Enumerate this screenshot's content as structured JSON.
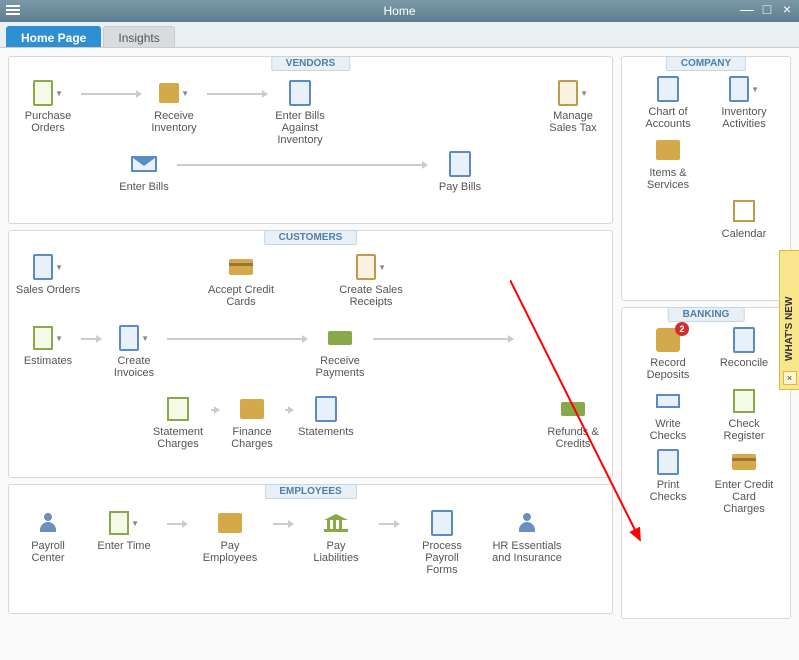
{
  "window": {
    "title": "Home"
  },
  "tabs": {
    "home": "Home Page",
    "insights": "Insights"
  },
  "vendors": {
    "header": "VENDORS",
    "po": "Purchase Orders",
    "receive_inv": "Receive Inventory",
    "enter_bills_inv": "Enter Bills Against Inventory",
    "manage_tax": "Manage Sales Tax",
    "enter_bills": "Enter Bills",
    "pay_bills": "Pay Bills"
  },
  "customers": {
    "header": "CUSTOMERS",
    "sales_orders": "Sales Orders",
    "accept_cc": "Accept Credit Cards",
    "create_receipts": "Create Sales Receipts",
    "estimates": "Estimates",
    "create_invoices": "Create Invoices",
    "receive_payments": "Receive Payments",
    "statement_charges": "Statement Charges",
    "finance_charges": "Finance Charges",
    "statements": "Statements",
    "refunds": "Refunds & Credits"
  },
  "employees": {
    "header": "EMPLOYEES",
    "payroll_center": "Payroll Center",
    "enter_time": "Enter Time",
    "pay_employees": "Pay Employees",
    "pay_liabilities": "Pay Liabilities",
    "process_forms": "Process Payroll Forms",
    "hr": "HR Essentials and Insurance"
  },
  "company": {
    "header": "COMPANY",
    "coa": "Chart of Accounts",
    "inv_act": "Inventory Activities",
    "items": "Items & Services",
    "calendar": "Calendar"
  },
  "banking": {
    "header": "BANKING",
    "record_deposits": "Record Deposits",
    "record_badge": "2",
    "reconcile": "Reconcile",
    "write_checks": "Write Checks",
    "check_register": "Check Register",
    "print_checks": "Print Checks",
    "enter_cc": "Enter Credit Card Charges"
  },
  "whats_new": {
    "label": "WHAT'S NEW",
    "close": "×"
  }
}
